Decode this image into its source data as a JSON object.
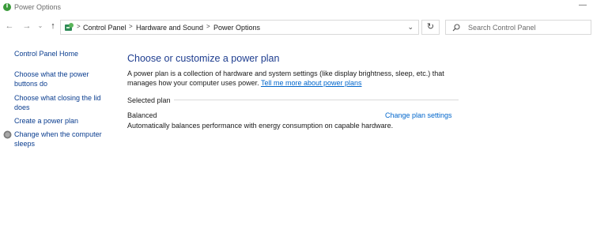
{
  "window": {
    "title": "Power Options"
  },
  "address": {
    "breadcrumbs": [
      "Control Panel",
      "Hardware and Sound",
      "Power Options"
    ]
  },
  "search": {
    "placeholder": "Search Control Panel"
  },
  "sidebar": {
    "home": "Control Panel Home",
    "items": [
      "Choose what the power buttons do",
      "Choose what closing the lid does",
      "Create a power plan",
      "Change when the computer sleeps"
    ]
  },
  "main": {
    "title": "Choose or customize a power plan",
    "description": "A power plan is a collection of hardware and system settings (like display brightness, sleep, etc.) that manages how your computer uses power.",
    "learn_more": "Tell me more about power plans",
    "group_label": "Selected plan",
    "plan": {
      "name": "Balanced",
      "change_link": "Change plan settings",
      "description": "Automatically balances performance with energy consumption on capable hardware."
    }
  },
  "icons": {
    "app": "power-options-icon",
    "back": "back-arrow-icon",
    "forward": "forward-arrow-icon",
    "up": "up-arrow-icon",
    "refresh": "refresh-icon",
    "search": "search-icon",
    "shield": "uac-shield-icon"
  },
  "colors": {
    "link": "#0066cc",
    "title": "#1e3d8f",
    "nav_link": "#0a3d8f"
  }
}
